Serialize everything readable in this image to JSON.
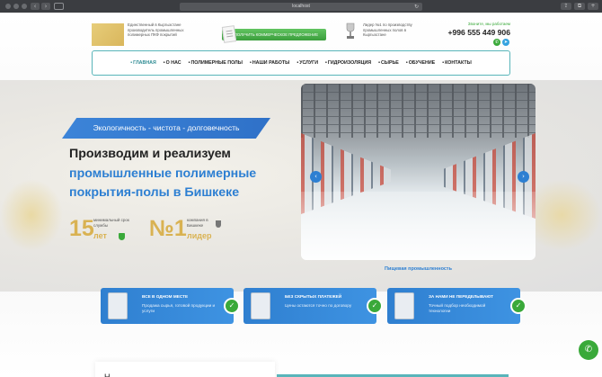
{
  "browser": {
    "url": "localhost",
    "reload_icon": "↻",
    "back": "‹",
    "forward": "›",
    "share": "⇪",
    "tabs": "⧉",
    "new_tab": "+"
  },
  "header": {
    "description": "Единственный в Кыргызстане производитель промышленных полимерных ПКФ покрытий",
    "offer_button": "ПОЛУЧИТЬ КОММЕРЧЕСКОЕ ПРЕДЛОЖЕНИЕ",
    "leader_text": "Лидер №1 по производству промышленных полов в Кыргызстане",
    "callme": "Звоните, мы работаем",
    "phone": "+996 555 449 906",
    "whatsapp_icon": "✆",
    "telegram_icon": "➤"
  },
  "nav": {
    "items": [
      {
        "label": "ГЛАВНАЯ",
        "active": true
      },
      {
        "label": "О НАС"
      },
      {
        "label": "ПОЛИМЕРНЫЕ ПОЛЫ"
      },
      {
        "label": "НАШИ РАБОТЫ"
      },
      {
        "label": "УСЛУГИ"
      },
      {
        "label": "ГИДРОИЗОЛЯЦИЯ"
      },
      {
        "label": "СЫРЬЕ"
      },
      {
        "label": "ОБУЧЕНИЕ"
      },
      {
        "label": "КОНТАКТЫ"
      }
    ]
  },
  "hero": {
    "tagline": "Экологичность - чистота - долговечность",
    "title_line1": "Производим и реализуем",
    "title_line2": "промышленные полимерные",
    "title_line3": "покрытия-полы в Бишкеке",
    "experience_number": "15",
    "experience_label": "минимальный срок службы",
    "experience_years": "лет",
    "rank_number": "№1",
    "rank_label": "компания в Бишкеке",
    "rank_leader": "лидер"
  },
  "slider": {
    "caption": "Пищевая промышленность",
    "prev": "‹",
    "next": "›"
  },
  "features": [
    {
      "title": "ВСЕ В ОДНОМ МЕСТЕ",
      "text": "Продажа сырья, готовой продукции и услуги",
      "check": "✓"
    },
    {
      "title": "БЕЗ СКРЫТЫХ ПЛАТЕЖЕЙ",
      "text": "Цены остаются точно по договору",
      "check": "✓"
    },
    {
      "title": "ЗА НАМИ НЕ ПЕРЕДЕЛЫВАЮТ",
      "text": "Точный подбор необходимой технологии",
      "check": "✓"
    }
  ],
  "bottom": {
    "heading_start": "Н",
    "whatsapp_float": "✆"
  }
}
